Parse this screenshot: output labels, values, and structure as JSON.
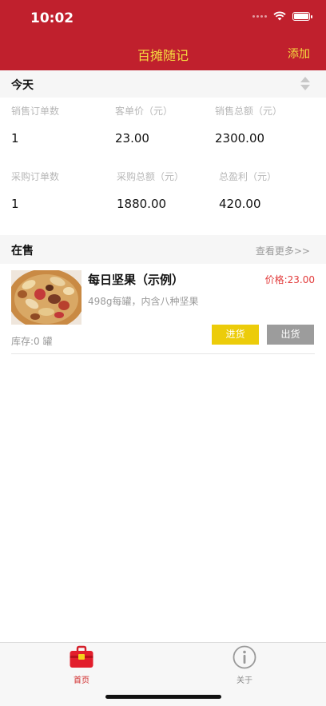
{
  "status_bar": {
    "time": "10:02"
  },
  "nav": {
    "title": "百摊随记",
    "add_label": "添加"
  },
  "today": {
    "label": "今天",
    "stats": [
      {
        "label": "销售订单数",
        "value": "1"
      },
      {
        "label": "客单价（元）",
        "value": "23.00"
      },
      {
        "label": "销售总额（元）",
        "value": "2300.00"
      },
      {
        "label": "采购订单数",
        "value": "1"
      },
      {
        "label": "采购总额（元）",
        "value": "1880.00"
      },
      {
        "label": "总盈利（元）",
        "value": "420.00"
      }
    ]
  },
  "on_sale": {
    "label": "在售",
    "more_label": "查看更多>>",
    "products": [
      {
        "name": "每日坚果（示例）",
        "price": "价格:23.00",
        "description": "498g每罐，内含八种坚果",
        "stock": "库存:0 罐",
        "restock_label": "进货",
        "sell_label": "出货"
      }
    ]
  },
  "tabs": [
    {
      "label": "首页",
      "icon": "briefcase-icon",
      "active": true
    },
    {
      "label": "关于",
      "icon": "info-icon",
      "active": false
    }
  ],
  "colors": {
    "brand_red": "#c0202d",
    "nav_yellow": "#f5dc40",
    "price_red": "#e23b3b",
    "restock_yellow": "#eccc0a",
    "sell_gray": "#9c9c9c"
  }
}
